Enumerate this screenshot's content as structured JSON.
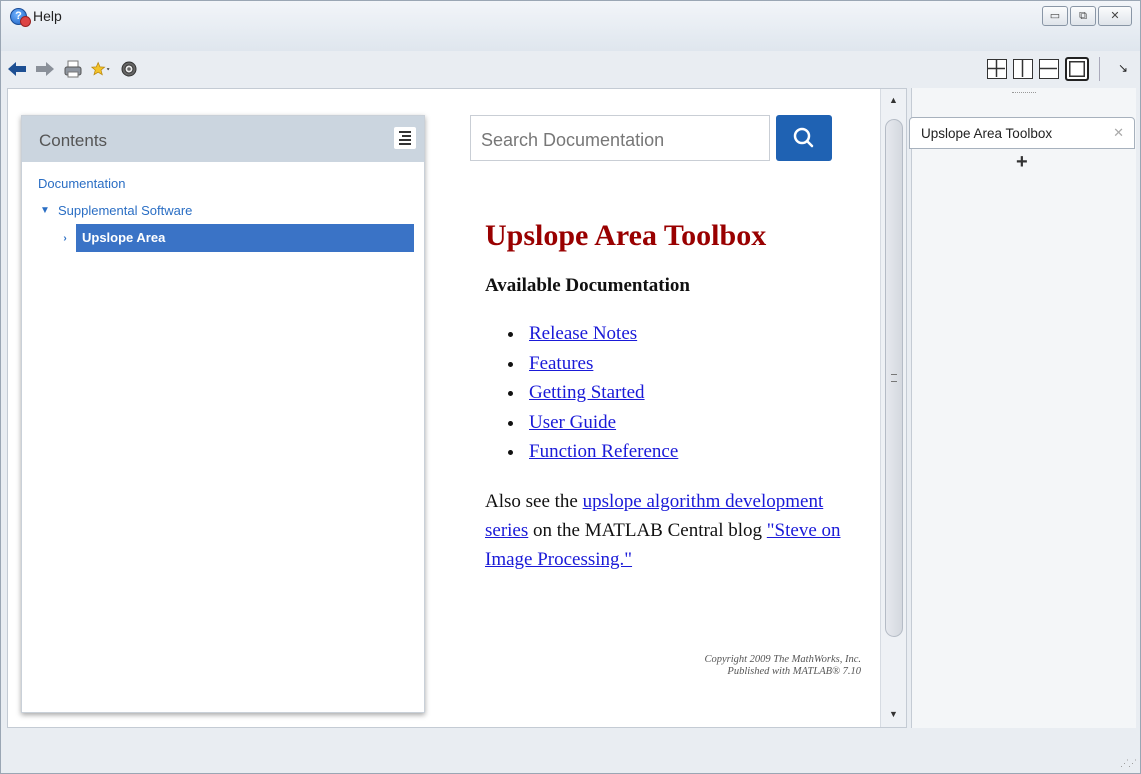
{
  "window": {
    "title": "Help",
    "minimize": "▭",
    "restore": "⧉",
    "close": "✕"
  },
  "toolbar": {
    "icons": [
      "back-arrow-icon",
      "forward-arrow-icon",
      "print-icon",
      "favorites-star-icon",
      "settings-gear-icon"
    ]
  },
  "layout": {
    "buttons": [
      "grid-2x2-layout",
      "columns-layout",
      "rows-layout",
      "single-layout"
    ],
    "active": "single-layout",
    "dock_arrow": "↘"
  },
  "toc": {
    "title": "Contents",
    "items": [
      {
        "label": "Documentation",
        "level": 0
      },
      {
        "label": "Supplemental Software",
        "level": 1,
        "expanded": true
      },
      {
        "label": "Upslope Area",
        "level": 2,
        "selected": true
      }
    ]
  },
  "search": {
    "placeholder": "Search Documentation"
  },
  "content": {
    "title": "Upslope Area Toolbox",
    "subtitle": "Available Documentation",
    "links": [
      "Release Notes",
      "Features",
      "Getting Started",
      "User Guide",
      "Function Reference"
    ],
    "also_see_prefix": "Also see the ",
    "also_see_link1": "upslope algorithm development series",
    "also_see_middle": " on the MATLAB Central blog ",
    "also_see_link2": "\"Steve on Image Processing.\"",
    "copyright_line1": "Copyright 2009 The MathWorks, Inc.",
    "copyright_line2": "Published with MATLAB® 7.10"
  },
  "right_panel": {
    "tab_label": "Upslope Area Toolbox",
    "tab_close": "✕",
    "add": "+"
  },
  "colors": {
    "accent": "#1f62b3",
    "toc_selected": "#3a73c6",
    "title_color": "#990000",
    "link_color": "#1a1ad8"
  }
}
